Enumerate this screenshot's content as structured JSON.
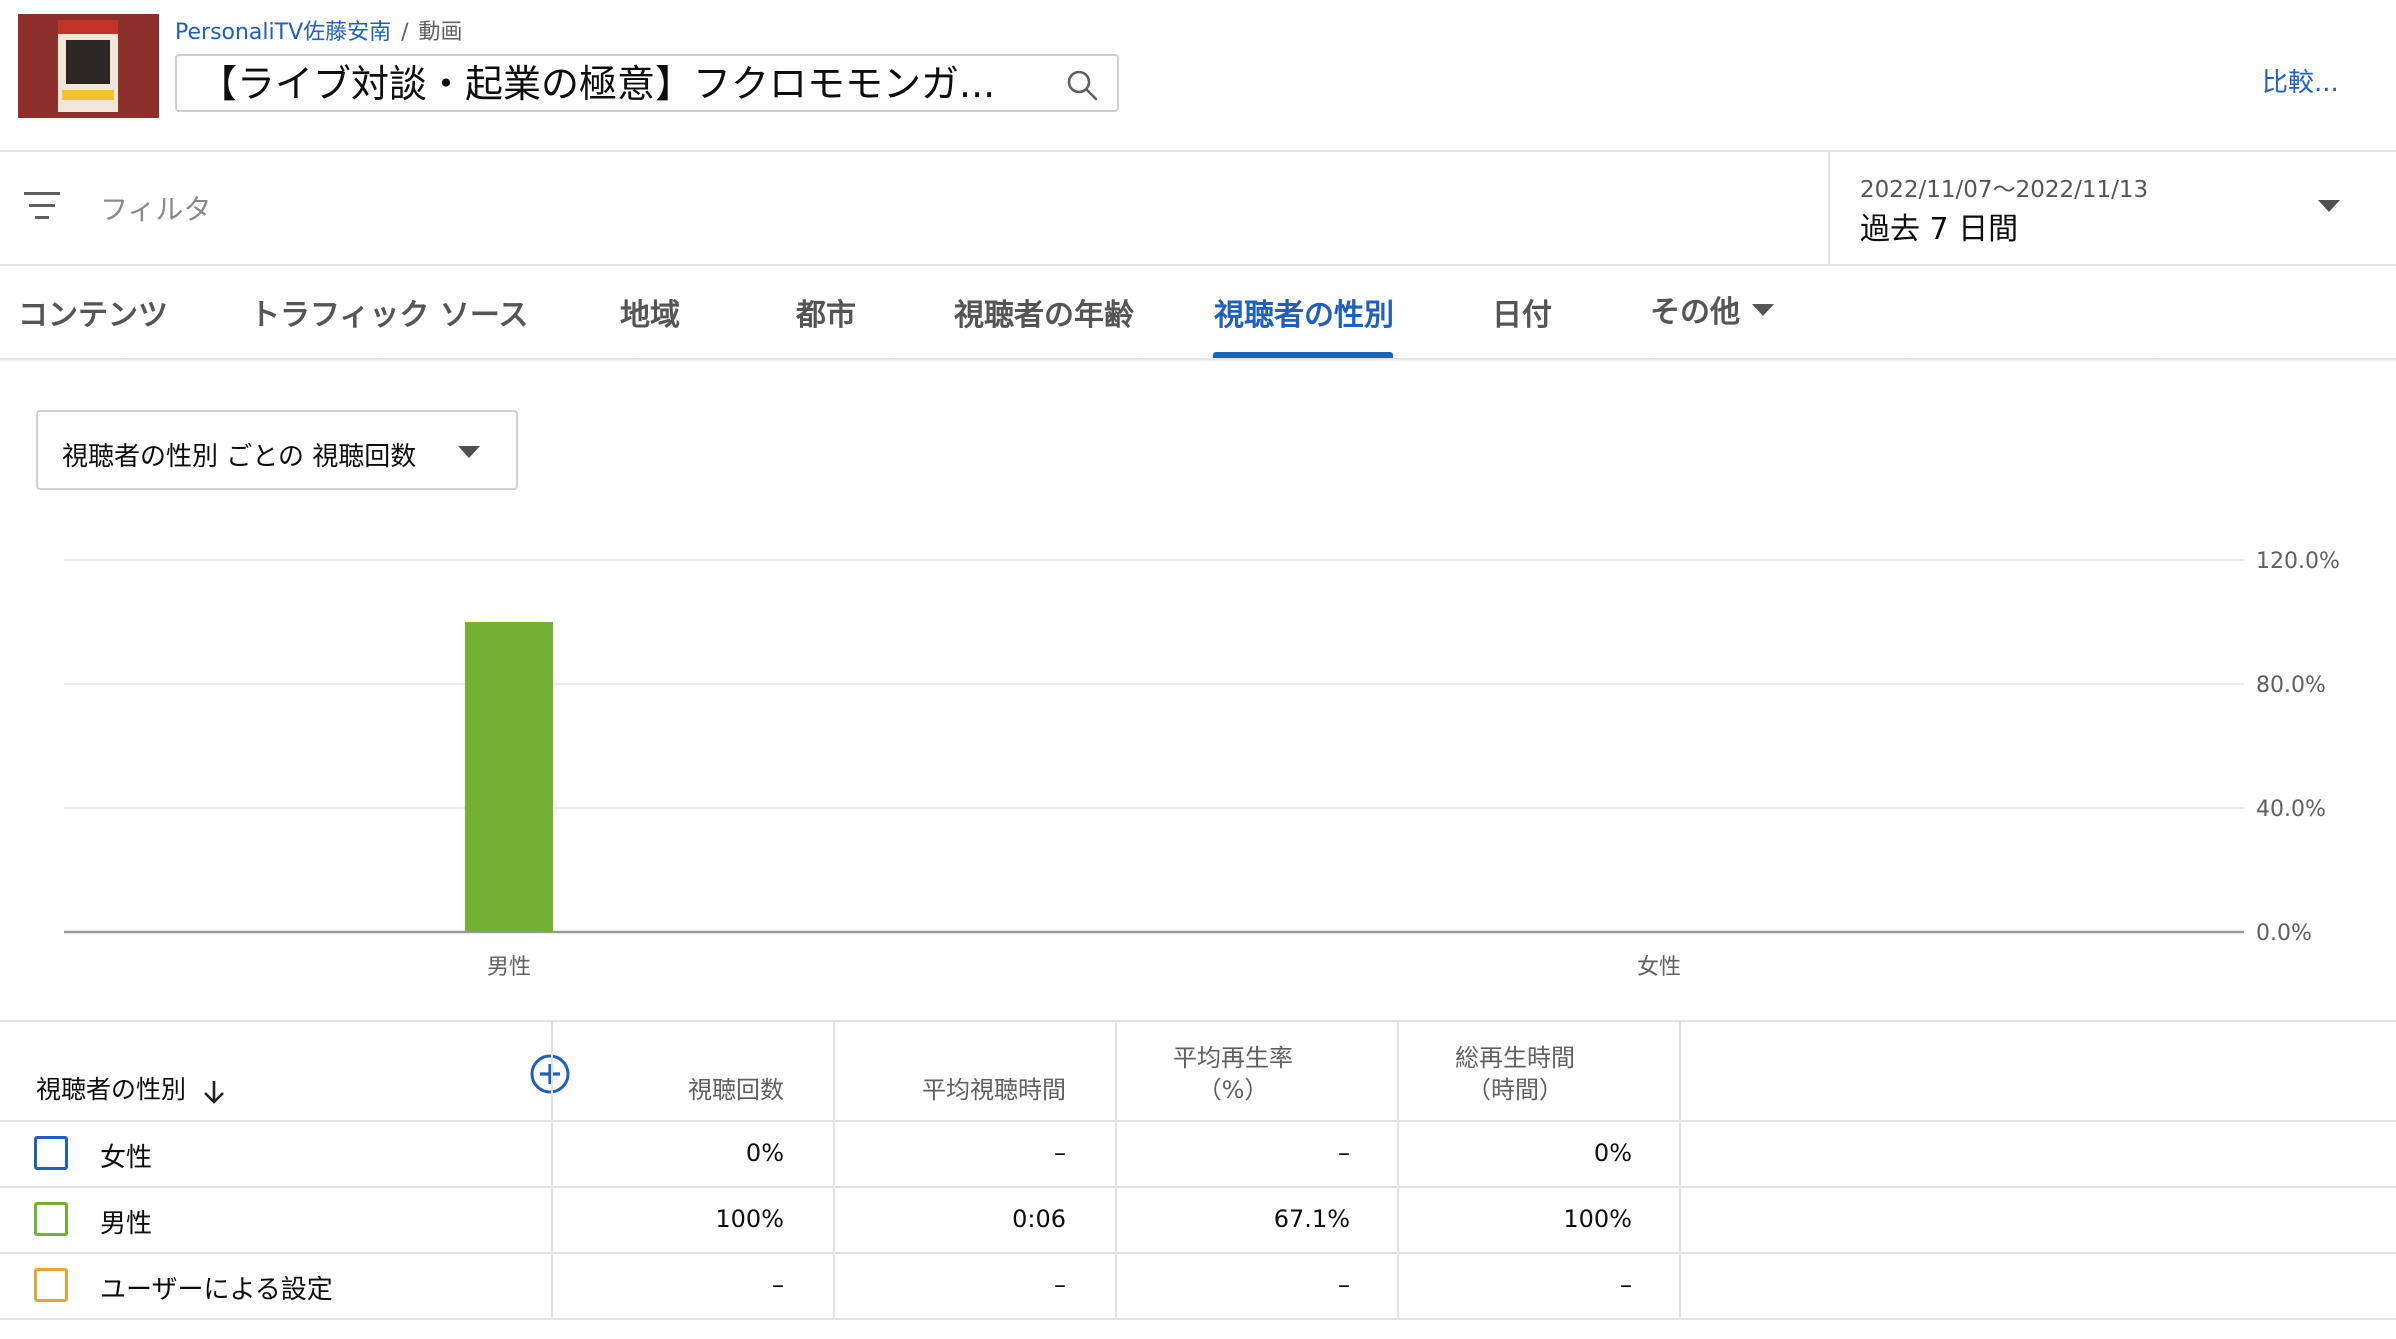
{
  "header": {
    "channel": "PersonaliTV佐藤安南",
    "separator": "/",
    "section": "動画",
    "video_title": "【ライブ対談・起業の極意】フクロモモンガ...",
    "compare_label": "比較..."
  },
  "filter": {
    "label": "フィルタ"
  },
  "date": {
    "range": "2022/11/07〜2022/11/13",
    "period": "過去 7 日間"
  },
  "tabs": [
    {
      "label": "コンテンツ"
    },
    {
      "label": "トラフィック ソース"
    },
    {
      "label": "地域"
    },
    {
      "label": "都市"
    },
    {
      "label": "視聴者の年齢"
    },
    {
      "label": "視聴者の性別",
      "active": true
    },
    {
      "label": "日付"
    },
    {
      "label": "その他"
    }
  ],
  "metric_select": {
    "label": "視聴者の性別 ごとの 視聴回数"
  },
  "chart_data": {
    "type": "bar",
    "categories": [
      "男性",
      "女性"
    ],
    "values": [
      100,
      0
    ],
    "bar_color": "#74b132",
    "ylim": [
      0,
      120
    ],
    "y_ticks": [
      "0.0%",
      "40.0%",
      "80.0%",
      "120.0%"
    ],
    "y_tick_values": [
      0,
      40,
      80,
      120
    ],
    "grid": true,
    "title": "",
    "xlabel": "",
    "ylabel": ""
  },
  "table": {
    "dimension_header": "視聴者の性別",
    "columns": [
      {
        "line1": "",
        "line2": "視聴回数"
      },
      {
        "line1": "",
        "line2": "平均視聴時間"
      },
      {
        "line1": "平均再生率",
        "line2": "（%）"
      },
      {
        "line1": "総再生時間",
        "line2": "（時間）"
      }
    ],
    "rows": [
      {
        "label": "女性",
        "color": "#1f5fbf",
        "values": [
          "0%",
          "–",
          "–",
          "0%"
        ]
      },
      {
        "label": "男性",
        "color": "#74b132",
        "values": [
          "100%",
          "0:06",
          "67.1%",
          "100%"
        ]
      },
      {
        "label": "ユーザーによる設定",
        "color": "#e8a33d",
        "values": [
          "–",
          "–",
          "–",
          "–"
        ]
      }
    ]
  },
  "icons": {
    "search": "search-icon",
    "filter": "filter-icon",
    "sort": "arrow-down-icon",
    "add": "add-circle-icon"
  }
}
